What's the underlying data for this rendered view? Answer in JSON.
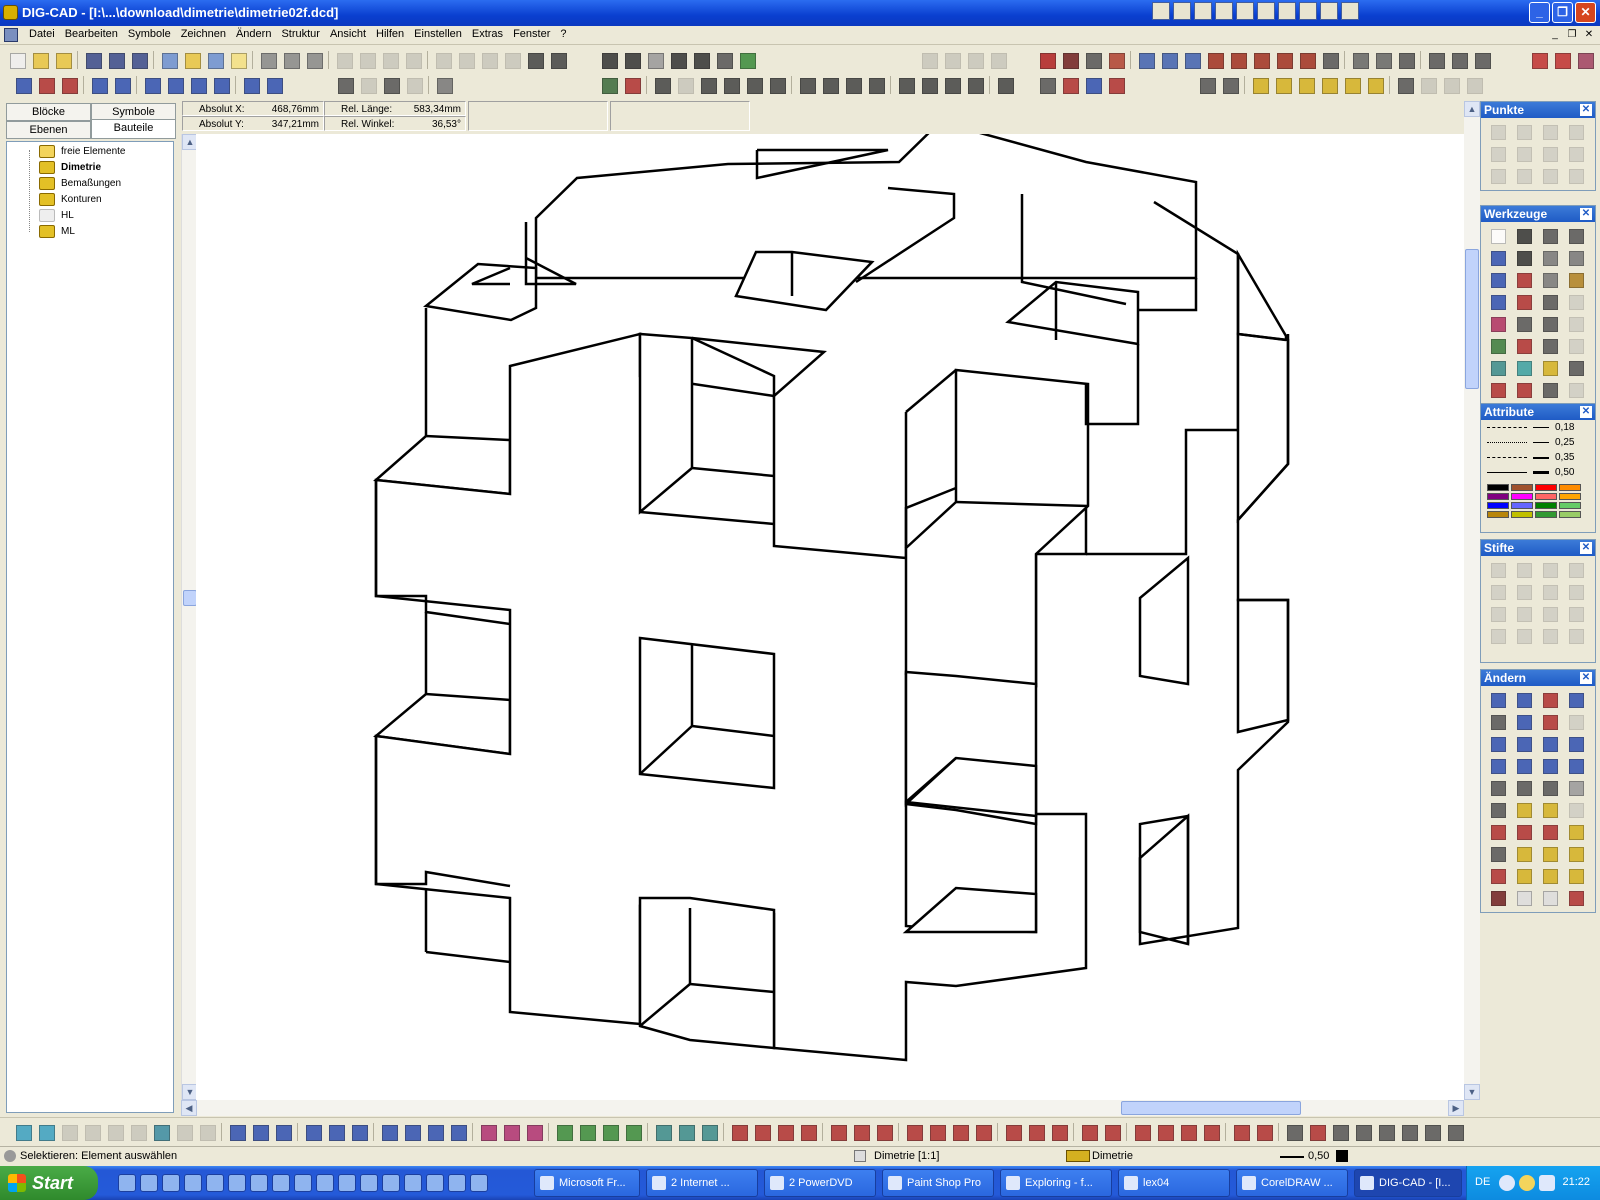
{
  "window": {
    "title": "DIG-CAD - [I:\\...\\download\\dimetrie\\dimetrie02f.dcd]",
    "controls": [
      "minimize",
      "maximize",
      "close"
    ]
  },
  "menu": [
    "Datei",
    "Bearbeiten",
    "Symbole",
    "Zeichnen",
    "Ändern",
    "Struktur",
    "Ansicht",
    "Hilfen",
    "Einstellen",
    "Extras",
    "Fenster",
    "?"
  ],
  "left_panel": {
    "tabs": [
      {
        "label": "Blöcke",
        "active": false
      },
      {
        "label": "Symbole",
        "active": false
      },
      {
        "label": "Ebenen",
        "active": false
      },
      {
        "label": "Bauteile",
        "active": true
      }
    ],
    "tree": [
      {
        "label": "freie Elemente",
        "bold": false,
        "folder": true
      },
      {
        "label": "Dimetrie",
        "bold": true,
        "folder": false
      },
      {
        "label": "Bemaßungen",
        "bold": false,
        "folder": false
      },
      {
        "label": "Konturen",
        "bold": false,
        "folder": false
      },
      {
        "label": "HL",
        "bold": false,
        "folder": false
      },
      {
        "label": "ML",
        "bold": false,
        "folder": false
      }
    ]
  },
  "coords": {
    "absolut_x_label": "Absolut X:",
    "absolut_x": "468,76mm",
    "absolut_y_label": "Absolut Y:",
    "absolut_y": "347,21mm",
    "rel_laenge_label": "Rel. Länge:",
    "rel_laenge": "583,34mm",
    "rel_winkel_label": "Rel. Winkel:",
    "rel_winkel": "36,53°"
  },
  "palettes": {
    "punkte": "Punkte",
    "werkzeuge": "Werkzeuge",
    "attribute": "Attribute",
    "stifte": "Stifte",
    "aendern": "Ändern",
    "line_widths": [
      "0,18",
      "0,25",
      "0,35",
      "0,50"
    ],
    "colors": [
      "#000000",
      "#a0522d",
      "#ff0000",
      "#ff8c00",
      "#800080",
      "#ff00ff",
      "#ff6666",
      "#ffa500",
      "#0000ff",
      "#6666ff",
      "#008000",
      "#66cc66",
      "#b8860b",
      "#c0c000",
      "#339933",
      "#99cc66"
    ]
  },
  "status": {
    "message": "Selektieren: Element auswählen",
    "view": "Dimetrie [1:1]",
    "layer": "Dimetrie",
    "line_width": "0,50"
  },
  "taskbar": {
    "start": "Start",
    "tasks": [
      {
        "label": "Microsoft Fr...",
        "active": false
      },
      {
        "label": "2 Internet ...",
        "active": false
      },
      {
        "label": "2 PowerDVD",
        "active": false
      },
      {
        "label": "Paint Shop Pro",
        "active": false
      },
      {
        "label": "Exploring - f...",
        "active": false
      },
      {
        "label": "lex04",
        "active": false
      },
      {
        "label": "CorelDRAW ...",
        "active": false
      },
      {
        "label": "DIG-CAD - [I...",
        "active": true
      }
    ],
    "language": "DE",
    "clock": "21:22"
  }
}
